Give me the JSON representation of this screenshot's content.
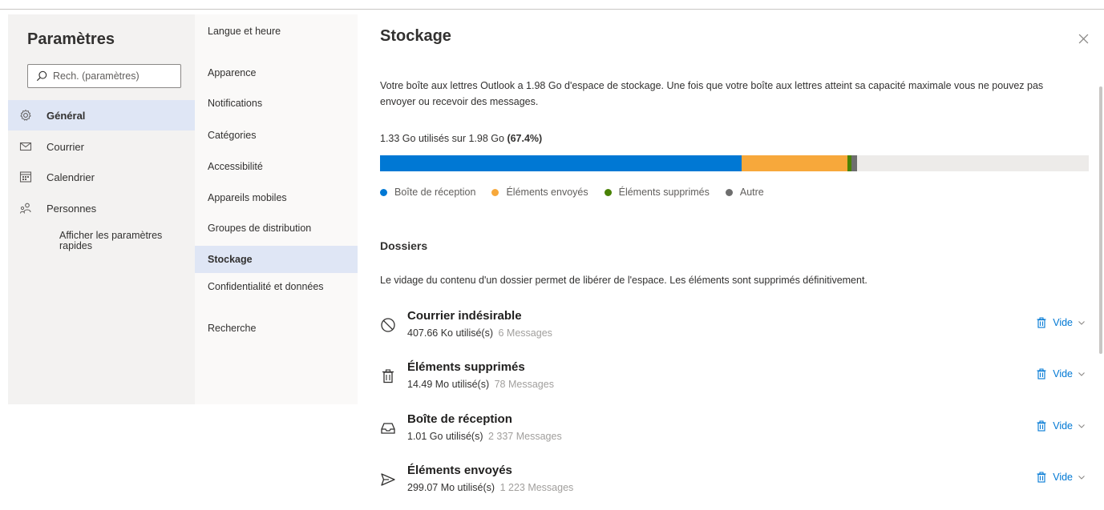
{
  "sidebar": {
    "title": "Paramètres",
    "search_placeholder": "Rech. (paramètres)",
    "items": [
      {
        "label": "Général",
        "icon": "gear-icon"
      },
      {
        "label": "Courrier",
        "icon": "mail-icon"
      },
      {
        "label": "Calendrier",
        "icon": "calendar-icon"
      },
      {
        "label": "Personnes",
        "icon": "people-icon"
      }
    ],
    "quick_settings_link": "Afficher les paramètres rapides"
  },
  "subnav": {
    "items": [
      {
        "label": "Langue et heure"
      },
      {
        "label": "Apparence"
      },
      {
        "label": "Notifications"
      },
      {
        "label": "Catégories"
      },
      {
        "label": "Accessibilité"
      },
      {
        "label": "Appareils mobiles"
      },
      {
        "label": "Groupes de distribution"
      },
      {
        "label": "Stockage"
      },
      {
        "label": "Confidentialité et données"
      },
      {
        "label": "Recherche"
      }
    ]
  },
  "storage": {
    "title": "Stockage",
    "description": "Votre boîte aux lettres Outlook a 1.98 Go d'espace de stockage. Une fois que votre boîte aux lettres atteint sa capacité maximale vous ne pouvez pas envoyer ou recevoir des messages.",
    "usage_text": "1.33 Go utilisés sur 1.98 Go",
    "usage_percent": "(67.4%)",
    "bar_segments": [
      {
        "label": "Boîte de réception",
        "fraction": 0.51,
        "color": "#0078d4"
      },
      {
        "label": "Éléments envoyés",
        "fraction": 0.149,
        "color": "#f7a83b"
      },
      {
        "label": "Éléments supprimés",
        "fraction": 0.006,
        "color": "#498205"
      },
      {
        "label": "Autre",
        "fraction": 0.008,
        "color": "#6e6e6e"
      }
    ],
    "legend": [
      {
        "label": "Boîte de réception",
        "color": "#0078d4"
      },
      {
        "label": "Éléments envoyés",
        "color": "#f7a83b"
      },
      {
        "label": "Éléments supprimés",
        "color": "#498205"
      },
      {
        "label": "Autre",
        "color": "#6e6e6e"
      }
    ]
  },
  "folders_section": {
    "title": "Dossiers",
    "description": "Le vidage du contenu d'un dossier permet de libérer de l'espace. Les éléments sont supprimés définitivement.",
    "empty_label": "Vide",
    "items": [
      {
        "name": "Courrier indésirable",
        "used": "407.66 Ko utilisé(s)",
        "count": "6 Messages",
        "icon": "blocked-icon"
      },
      {
        "name": "Éléments supprimés",
        "used": "14.49 Mo utilisé(s)",
        "count": "78 Messages",
        "icon": "trash-icon"
      },
      {
        "name": "Boîte de réception",
        "used": "1.01 Go utilisé(s)",
        "count": "2 337 Messages",
        "icon": "inbox-icon"
      },
      {
        "name": "Éléments envoyés",
        "used": "299.07 Mo utilisé(s)",
        "count": "1 223 Messages",
        "icon": "send-icon"
      }
    ]
  }
}
